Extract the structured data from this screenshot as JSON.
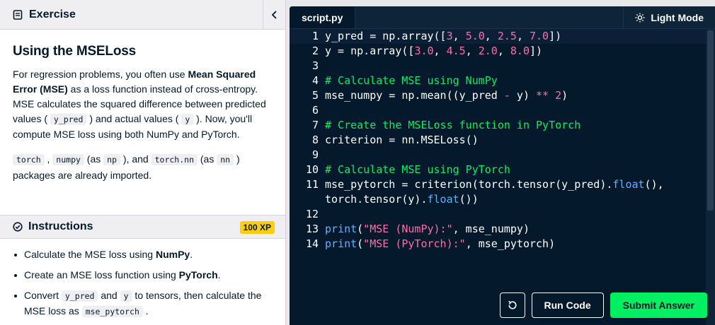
{
  "colors": {
    "accent_green": "#03ef62",
    "editor_bg": "#05192d",
    "xp_badge": "#fcce0d",
    "number": "#ff6ea9",
    "comment": "#03ef62",
    "keyword": "#5eb1ff"
  },
  "exercise": {
    "header_label": "Exercise",
    "header_icon": "document-icon",
    "collapse_icon": "chevron-left-icon",
    "title": "Using the MSELoss",
    "p1": {
      "t1": "For regression problems, you often use ",
      "b1": "Mean Squared Error (MSE)",
      "t2": " as a loss function instead of cross-entropy. MSE calculates the squared difference between predicted values ( ",
      "c1": "y_pred",
      "t3": " ) and actual values ( ",
      "c2": "y",
      "t4": " ). Now, you'll compute MSE loss using both NumPy and PyTorch."
    },
    "p2": {
      "c1": "torch",
      "t1": " , ",
      "c2": "numpy",
      "t2": " (as ",
      "c3": "np",
      "t3": " ), and ",
      "c4": "torch.nn",
      "t4": " (as ",
      "c5": "nn",
      "t5": " ) packages are already imported."
    }
  },
  "instructions": {
    "header_label": "Instructions",
    "header_icon": "check-circle-icon",
    "xp": "100 XP",
    "items": [
      {
        "t1": "Calculate the MSE loss using ",
        "b1": "NumPy",
        "t2": "."
      },
      {
        "t1": "Create an MSE loss function using ",
        "b1": "PyTorch",
        "t2": "."
      },
      {
        "t1": "Convert ",
        "c1": "y_pred",
        "t2": " and ",
        "c2": "y",
        "t3": " to tensors, then calculate the MSE loss as ",
        "c3": "mse_pytorch",
        "t4": " ."
      }
    ]
  },
  "editor": {
    "tab_label": "script.py",
    "mode_label": "Light Mode",
    "mode_icon": "sun-icon",
    "line_numbers": [
      "1",
      "2",
      "3",
      "4",
      "5",
      "6",
      "7",
      "8",
      "9",
      "10",
      "11",
      "",
      "12",
      "13",
      "14"
    ],
    "lines": [
      {
        "a": "y_pred = np.array([",
        "n1": "3",
        "b": ", ",
        "n2": "5.0",
        "c": ", ",
        "n3": "2.5",
        "d": ", ",
        "n4": "7.0",
        "e": "])"
      },
      {
        "a": "y = np.array([",
        "n1": "3.0",
        "b": ", ",
        "n2": "4.5",
        "c": ", ",
        "n3": "2.0",
        "d": ", ",
        "n4": "8.0",
        "e": "])"
      },
      {
        "text": ""
      },
      {
        "comment": "# Calculate MSE using NumPy"
      },
      {
        "a": "mse_numpy = np.mean((y_pred ",
        "op1": "-",
        "b": " y) ",
        "op2": "**",
        "c": " ",
        "n1": "2",
        "d": ")"
      },
      {
        "text": ""
      },
      {
        "comment": "# Create the MSELoss function in PyTorch"
      },
      {
        "text": "criterion = nn.MSELoss()"
      },
      {
        "text": ""
      },
      {
        "comment": "# Calculate MSE using PyTorch"
      },
      {
        "a": "mse_pytorch = criterion(torch.tensor(y_pred).",
        "k1": "float",
        "b": "(),"
      },
      {
        "a": "torch.tensor(y).",
        "k1": "float",
        "b": "())"
      },
      {
        "text": ""
      },
      {
        "k1": "print",
        "a": "(",
        "s1": "\"MSE (NumPy):\"",
        "b": ", mse_numpy)"
      },
      {
        "k1": "print",
        "a": "(",
        "s1": "\"MSE (PyTorch):\"",
        "b": ", mse_pytorch)"
      }
    ],
    "reset_icon": "reset-icon",
    "run_label": "Run Code",
    "submit_label": "Submit Answer"
  }
}
